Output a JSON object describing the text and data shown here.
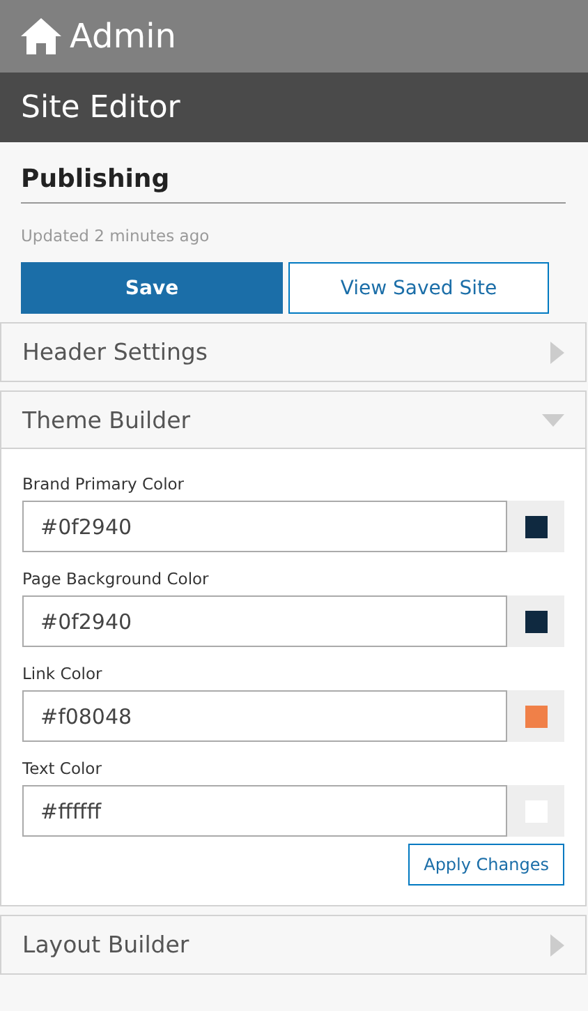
{
  "app_bar": {
    "title": "Admin"
  },
  "editor_bar": {
    "title": "Site Editor"
  },
  "publishing": {
    "title": "Publishing",
    "status": "Updated 2 minutes ago",
    "buttons": [
      {
        "label": "Save",
        "kind": "primary"
      },
      {
        "label": "View Saved Site",
        "kind": "secondary"
      }
    ]
  },
  "sections": [
    {
      "title": "Header Settings",
      "expanded": false
    },
    {
      "title": "Theme Builder",
      "expanded": true,
      "fields": [
        {
          "label": "Brand Primary Color",
          "value": "#0f2940",
          "color": "#0f2940"
        },
        {
          "label": "Page Background Color",
          "value": "#0f2940",
          "color": "#0f2940"
        },
        {
          "label": "Link Color",
          "value": "#f08048",
          "color": "#f08048"
        },
        {
          "label": "Text Color",
          "value": "#ffffff",
          "color": "#ffffff"
        }
      ],
      "action": "Apply Changes"
    },
    {
      "title": "Layout Builder",
      "expanded": false
    }
  ]
}
